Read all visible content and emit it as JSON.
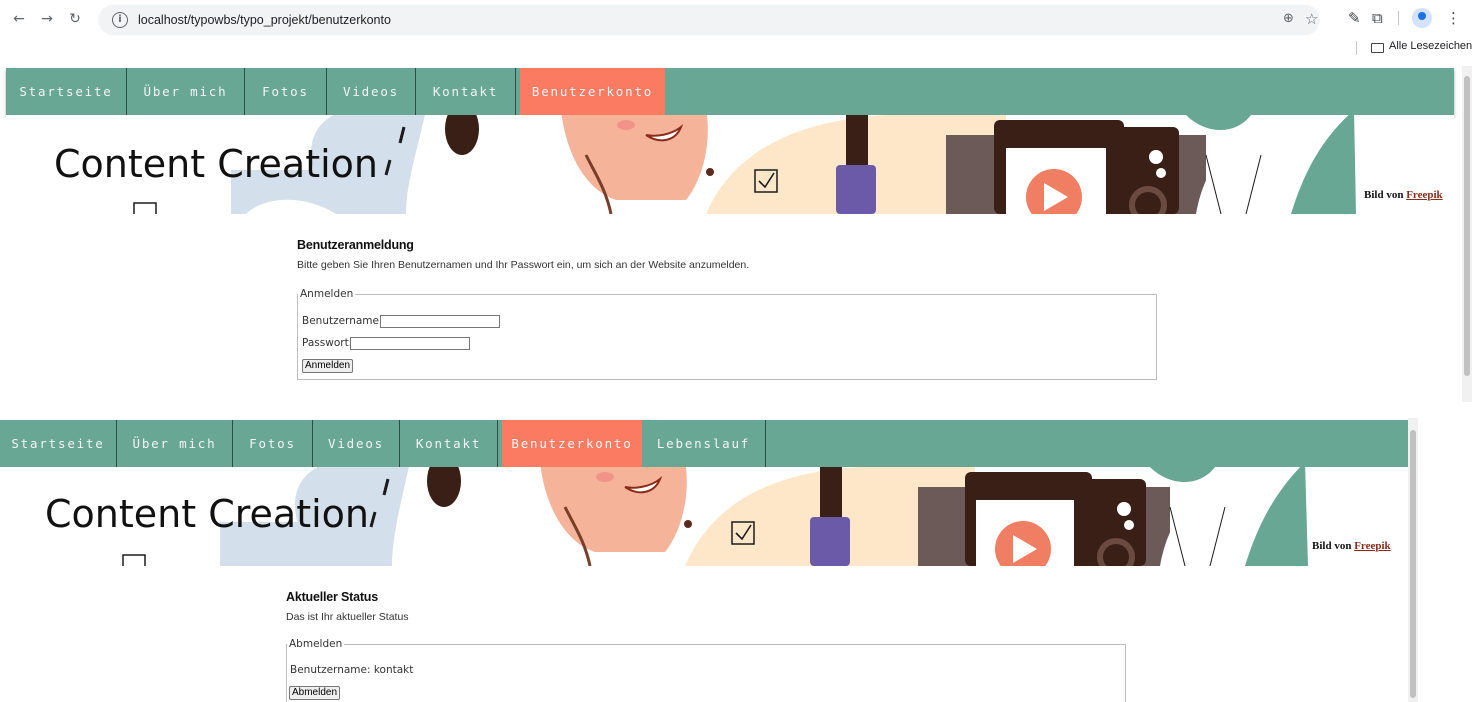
{
  "browser": {
    "url": "localhost/typowbs/typo_projekt/benutzerkonto",
    "bookmarks_label": "Alle Lesezeichen",
    "icons": [
      "back-arrow-icon",
      "forward-arrow-icon",
      "reload-icon",
      "site-info-icon",
      "zoom-icon",
      "bookmark-star-icon",
      "eyedropper-icon",
      "extensions-icon",
      "profile-icon",
      "menu-dots-icon",
      "folder-icon"
    ]
  },
  "colors": {
    "nav": "#67a794",
    "nav_active": "#fa7b62",
    "credit_link": "#8a2b1c"
  },
  "page1": {
    "nav": [
      "Startseite",
      "Über mich",
      "Fotos",
      "Videos",
      "Kontakt",
      "Benutzerkonto"
    ],
    "active": "Benutzerkonto",
    "banner_title": "Content Creation",
    "credit_prefix": "Bild von",
    "credit_link": "Freepik",
    "title": "Benutzeranmeldung",
    "description": "Bitte geben Sie Ihren Benutzernamen und Ihr Passwort ein, um sich an der Website anzumelden.",
    "legend": "Anmelden",
    "username_label": "Benutzername:",
    "password_label": "Passwort:",
    "submit": "Anmelden"
  },
  "page2": {
    "nav": [
      "Startseite",
      "Über mich",
      "Fotos",
      "Videos",
      "Kontakt",
      "Benutzerkonto",
      "Lebenslauf"
    ],
    "active": "Benutzerkonto",
    "banner_title": "Content Creation",
    "credit_prefix": "Bild von",
    "credit_link": "Freepik",
    "title": "Aktueller Status",
    "description": "Das ist Ihr aktueller Status",
    "legend": "Abmelden",
    "username_line": "Benutzername: kontakt",
    "submit": "Abmelden"
  }
}
